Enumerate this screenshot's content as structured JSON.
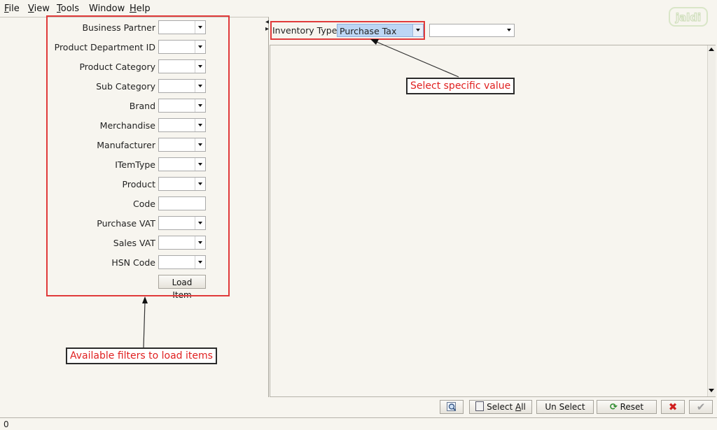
{
  "menu": [
    {
      "first": "F",
      "rest": "ile"
    },
    {
      "first": "V",
      "rest": "iew"
    },
    {
      "first": "T",
      "rest": "ools"
    },
    {
      "first": "",
      "rest": "Window"
    },
    {
      "first": "H",
      "rest": "elp"
    }
  ],
  "watermark": {
    "text": "jaldi"
  },
  "filters": {
    "items": [
      {
        "label": "Business Partner",
        "type": "combo"
      },
      {
        "label": "Product Department ID",
        "type": "combo"
      },
      {
        "label": "Product Category",
        "type": "combo"
      },
      {
        "label": "Sub Category",
        "type": "combo"
      },
      {
        "label": "Brand",
        "type": "combo"
      },
      {
        "label": "Merchandise",
        "type": "combo"
      },
      {
        "label": "Manufacturer",
        "type": "combo"
      },
      {
        "label": "ITemType",
        "type": "combo"
      },
      {
        "label": "Product",
        "type": "combo"
      },
      {
        "label": "Code",
        "type": "text"
      },
      {
        "label": "Purchase VAT",
        "type": "combo"
      },
      {
        "label": "Sales VAT",
        "type": "combo"
      },
      {
        "label": "HSN Code",
        "type": "combo"
      }
    ],
    "load_button": "Load Item"
  },
  "inventory": {
    "label": "Inventory Type",
    "value": "Purchase Tax",
    "second_value": ""
  },
  "annotations": {
    "filters_callout": "Available filters to load items",
    "select_callout": "Select specific value",
    "color": "#e02020"
  },
  "toolbar": {
    "zoom_icon": "zoom-icon",
    "select_all_prefix": "Select ",
    "select_all_u": "A",
    "select_all_rest": "ll",
    "unselect": "Un Select",
    "reset": "Reset",
    "cancel_icon": "red-x-icon",
    "ok_icon": "checkmark-icon"
  },
  "status": {
    "text": "0"
  }
}
